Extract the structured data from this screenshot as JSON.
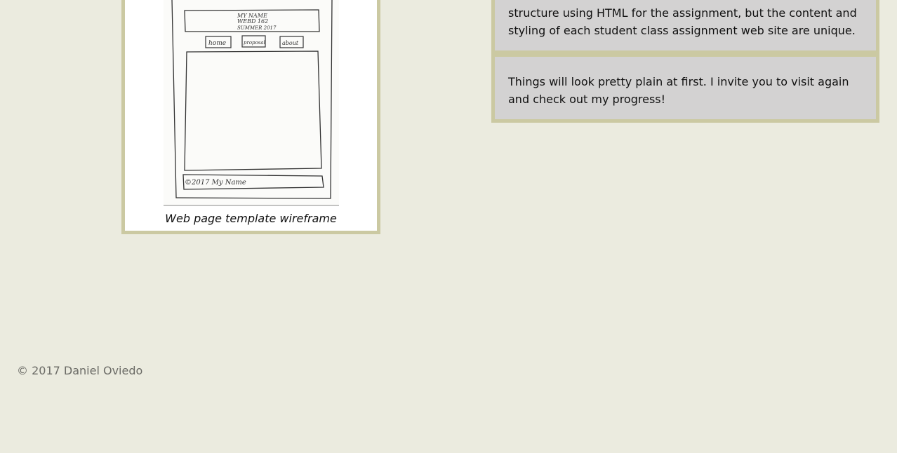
{
  "figure": {
    "caption": "Web page template wireframe",
    "sketch": {
      "header_line1": "MY NAME",
      "header_line2": "WEBD 162",
      "header_line3": "SUMMER 2017",
      "nav_home": "home",
      "nav_proposal": "proposal",
      "nav_about": "about",
      "footer_text": "©2017  My Name"
    }
  },
  "content": {
    "paragraph1": "structure using HTML for the assignment, but the content and styling of each student class assignment web site are unique.",
    "paragraph2": "Things will look pretty plain at first. I invite you to visit again and check out my progress!"
  },
  "footer": {
    "copyright": "© 2017 Daniel Oviedo"
  },
  "colors": {
    "background": "#ebebdf",
    "border": "#cbc9a2",
    "box_background": "#d3d2d2"
  }
}
